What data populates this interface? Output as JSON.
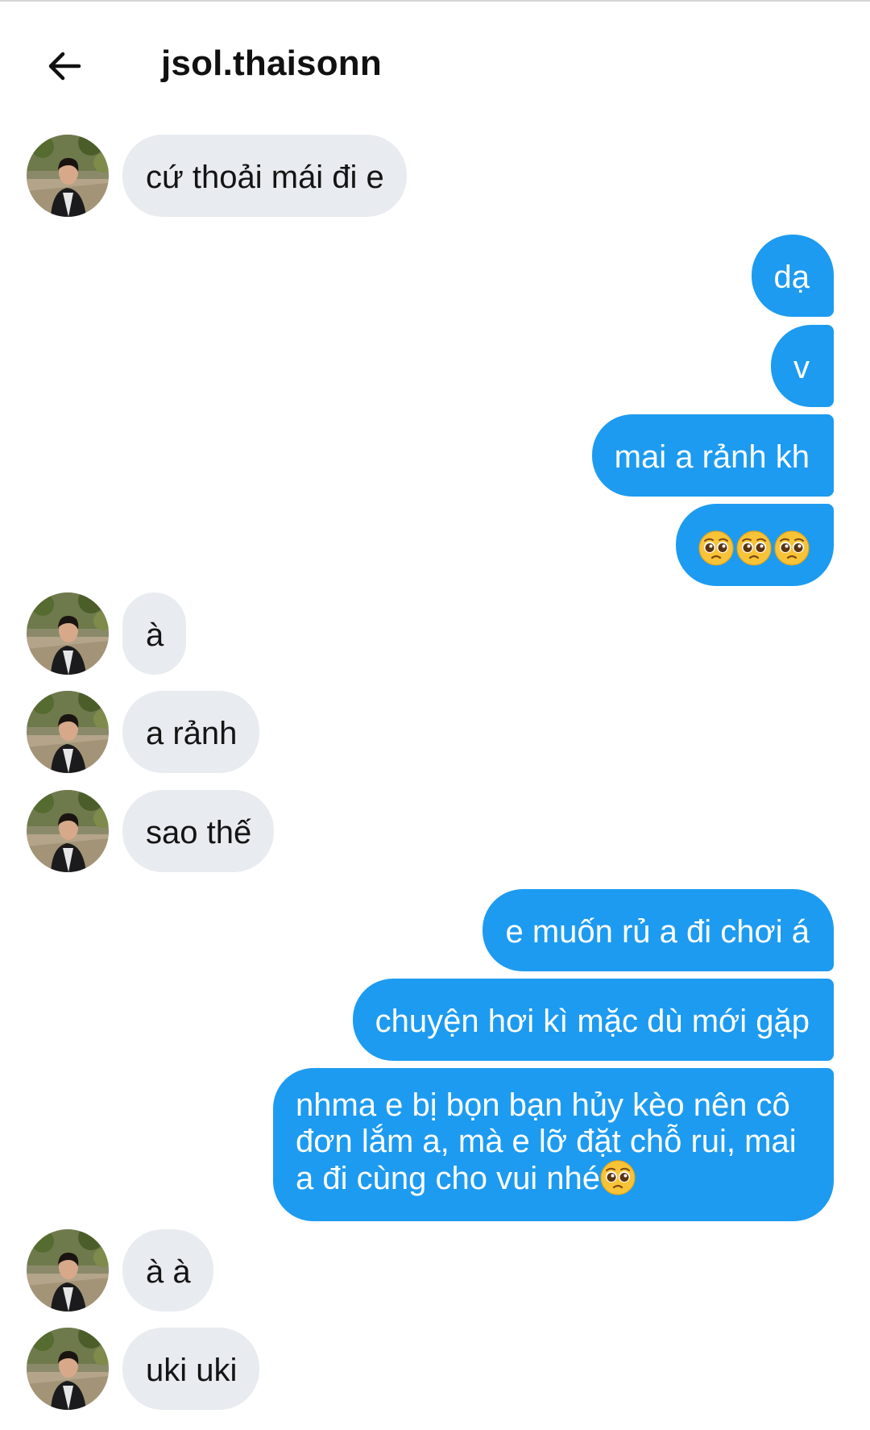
{
  "header": {
    "back_icon": "arrow-left-icon",
    "title": "jsol.thaisonn"
  },
  "colors": {
    "incoming_bubble": "#e8ebef",
    "outgoing_bubble": "#1d9bf0",
    "outgoing_text": "#ffffff",
    "incoming_text": "#141414"
  },
  "messages": [
    {
      "from": "them",
      "text": "cứ thoải mái đi e"
    },
    {
      "from": "me",
      "text": "dạ"
    },
    {
      "from": "me",
      "text": "v"
    },
    {
      "from": "me",
      "text": "mai a rảnh kh"
    },
    {
      "from": "me",
      "emoji": [
        "pleading-face-icon",
        "pleading-face-icon",
        "pleading-face-icon"
      ]
    },
    {
      "from": "them",
      "text": "à"
    },
    {
      "from": "them",
      "text": "a rảnh"
    },
    {
      "from": "them",
      "text": "sao thế"
    },
    {
      "from": "me",
      "text": "e muốn rủ a đi chơi á"
    },
    {
      "from": "me",
      "text": "chuyện hơi kì mặc dù mới gặp"
    },
    {
      "from": "me",
      "text": "nhma e bị bọn bạn hủy kèo nên cô đơn lắm a, mà e lỡ đặt chỗ rui, mai a đi cùng cho vui nhé",
      "trailing_emoji": "pleading-face-icon"
    },
    {
      "from": "them",
      "text": "à à"
    },
    {
      "from": "them",
      "text": "uki uki"
    }
  ]
}
